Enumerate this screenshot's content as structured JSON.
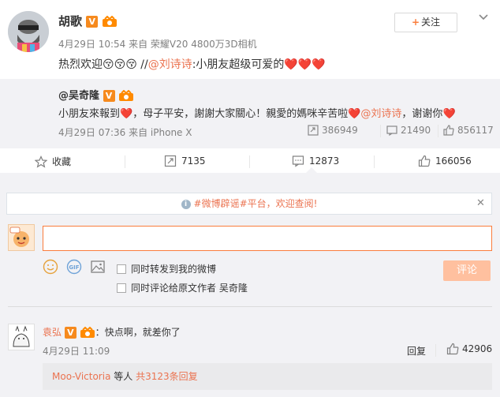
{
  "post": {
    "author": "胡歌",
    "verified_badge": "V",
    "meta": "4月29日 10:54 来自 荣耀V20 4800万3D相机",
    "follow_label": "关注",
    "text_prefix": "热烈欢迎",
    "text_emojis": "😚😚😚",
    "text_sep": " //",
    "mention": "@刘诗诗",
    "text_rest": ":小朋友超级可爱的",
    "text_hearts": "❤️❤️❤️"
  },
  "repost": {
    "author": "@吴奇隆",
    "verified_badge": "V",
    "text_a": "小朋友來報到",
    "text_b": "，母子平安，謝謝大家關心！親愛的媽咪辛苦啦",
    "mention": "@刘诗诗",
    "text_c": "，谢谢你",
    "heart": "❤️",
    "meta": "4月29日 07:36 来自 iPhone X",
    "reposts": "386949",
    "comments": "21490",
    "likes": "856117"
  },
  "actions": {
    "favorite": "收藏",
    "repost": "7135",
    "comment": "12873",
    "like": "166056"
  },
  "comment_box": {
    "notice": "#微博辟谣#平台，欢迎查阅!",
    "option_forward": "同时转发到我的微博",
    "option_origin": "同时评论给原文作者 吴奇隆",
    "submit_label": "评论"
  },
  "comments": [
    {
      "author": "袁弘",
      "text": "快点啊，就差你了",
      "time": "4月29日 11:09",
      "reply_label": "回复",
      "likes": "42906",
      "reply_user": "Moo-Victoria",
      "reply_mid": " 等人 ",
      "reply_count": "共3123条回复"
    }
  ],
  "colors": {
    "accent": "#eb7350",
    "verified": "#f68a1e",
    "submit_disabled": "#ffc09f",
    "panel": "#f2f2f5"
  }
}
